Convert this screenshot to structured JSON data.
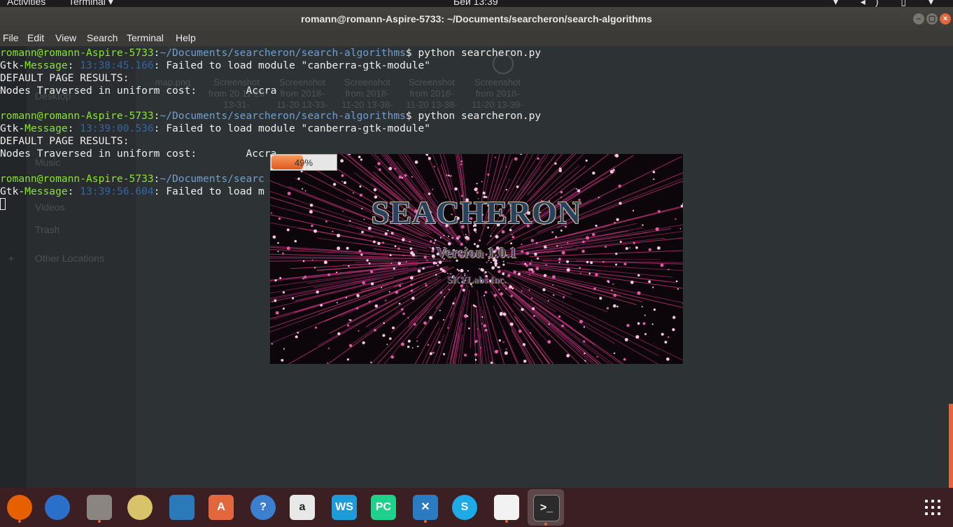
{
  "top_bar": {
    "activities": "Activities",
    "app_menu": "Terminal ▾",
    "clock": "Беи 13:39",
    "tray": "▾ ◂) ▯ ▾"
  },
  "window": {
    "title": "romann@romann-Aspire-5733: ~/Documents/searcheron/search-algorithms",
    "min": "–",
    "max": "▢",
    "close": "×"
  },
  "menu": [
    "File",
    "Edit",
    "View",
    "Search",
    "Terminal",
    "Help"
  ],
  "terminal": {
    "prompt_user": "romann@romann-Aspire-5733",
    "prompt_colon": ":",
    "prompt_path": "~/Documents/searcheron/search-algorithms",
    "prompt_dollar": "$ ",
    "command": "python searcheron.py",
    "gtk_prefix": "Gtk-",
    "gtk_label": "Message",
    "gtk_colon": ": ",
    "time1": "13:38:45.166",
    "time2": "13:39:00.536",
    "time3": "13:39:56.604",
    "error_msg": ": Failed to load module \"canberra-gtk-module\"",
    "error_msg_trunc": ": Failed to load m",
    "prompt_path_trunc": "~/Documents/searc",
    "default_results": "DEFAULT PAGE RESULTS:",
    "nodes_line": "Nodes Traversed in uniform cost:        Accra"
  },
  "background_window": {
    "sidebar": [
      "Desktop",
      "Music",
      "Videos",
      "Trash",
      "Other Locations"
    ],
    "files": [
      {
        "name": "map.png"
      },
      {
        "name": "Screenshot from 20 11-20 13-31-"
      },
      {
        "name": "Screenshot from 2018- 11-20 13-33-"
      },
      {
        "name": "Screenshot from 2018- 11-20 13-38-"
      },
      {
        "name": "Screenshot from 2018- 11-20 13-38-"
      },
      {
        "name": "Screenshot from 2018- 11-20 13-39-"
      }
    ]
  },
  "splash": {
    "progress_percent": 49,
    "progress_label": "49%",
    "title": "SEACHERON",
    "version": "Version 1.0.1",
    "company": "SKYLabs Inc."
  },
  "dock": [
    {
      "name": "firefox-icon",
      "glyph": "",
      "color": "#e66000",
      "running": true
    },
    {
      "name": "thunderbird-icon",
      "glyph": "",
      "color": "#2a6fc9",
      "running": false
    },
    {
      "name": "files-icon",
      "glyph": "",
      "color": "#8a8580",
      "running": true
    },
    {
      "name": "rhythmbox-icon",
      "glyph": "",
      "color": "#d9c36a",
      "running": false
    },
    {
      "name": "libreoffice-writer-icon",
      "glyph": "",
      "color": "#2a7ab9",
      "running": false
    },
    {
      "name": "software-center-icon",
      "glyph": "A",
      "color": "#e2673d",
      "running": false
    },
    {
      "name": "help-icon",
      "glyph": "?",
      "color": "#3d7fcf",
      "running": false
    },
    {
      "name": "amazon-icon",
      "glyph": "a",
      "color": "#e8e8e8",
      "running": false
    },
    {
      "name": "webstorm-icon",
      "glyph": "WS",
      "color": "#1f9bd9",
      "running": false
    },
    {
      "name": "pycharm-icon",
      "glyph": "PC",
      "color": "#1fd18c",
      "running": false
    },
    {
      "name": "vscode-icon",
      "glyph": "✕",
      "color": "#2b7bc2",
      "running": true
    },
    {
      "name": "skype-icon",
      "glyph": "S",
      "color": "#1eaae7",
      "running": false
    },
    {
      "name": "pdf-reader-icon",
      "glyph": "",
      "color": "#f2f2f2",
      "running": true
    },
    {
      "name": "terminal-icon",
      "glyph": ">_",
      "color": "#2b2b2b",
      "running": true
    }
  ],
  "colors": {
    "accent": "#e2673d",
    "terminal_bg": "#2d3234",
    "prompt_user": "#8ae234",
    "prompt_path": "#729fcf",
    "dock_bg": "#3b1f22"
  }
}
